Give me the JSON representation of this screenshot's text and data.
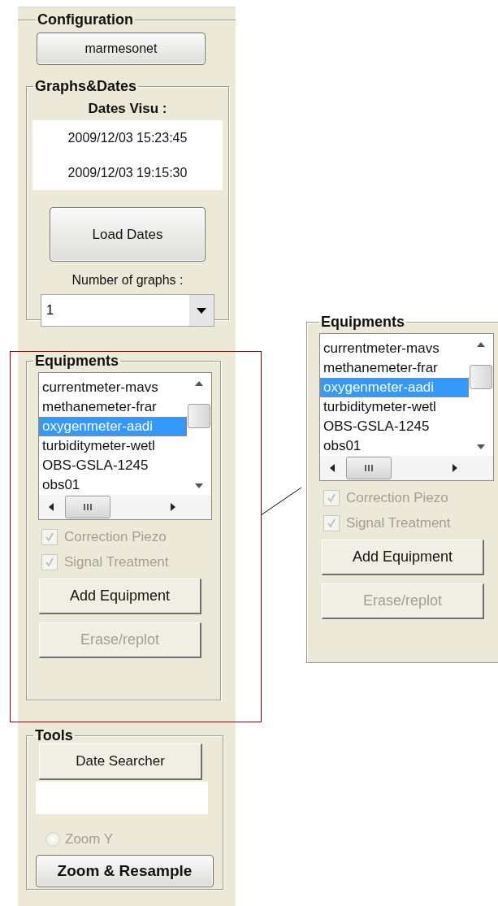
{
  "configuration": {
    "title": "Configuration",
    "button": "marmesonet"
  },
  "graphs_dates": {
    "title": "Graphs&Dates",
    "dates_label": "Dates Visu :",
    "dates": [
      "2009/12/03 15:23:45",
      "2009/12/03 19:15:30"
    ],
    "load_button": "Load Dates",
    "graphs_label": "Number of graphs :",
    "graphs_value": "1"
  },
  "equipments": {
    "title": "Equipments",
    "items": [
      {
        "label": "currentmeter-mavs",
        "selected": false
      },
      {
        "label": "methanemeter-frar",
        "selected": false
      },
      {
        "label": "oxygenmeter-aadi",
        "selected": true
      },
      {
        "label": "turbiditymeter-wetl",
        "selected": false
      },
      {
        "label": "OBS-GSLA-1245",
        "selected": false
      },
      {
        "label": "obs01",
        "selected": false
      }
    ],
    "checkboxes": [
      {
        "label": "Correction Piezo",
        "checked": true,
        "disabled": true
      },
      {
        "label": "Signal Treatment",
        "checked": true,
        "disabled": true
      }
    ],
    "buttons": [
      {
        "label": "Add Equipment",
        "disabled": false
      },
      {
        "label": "Erase/replot",
        "disabled": true
      }
    ]
  },
  "equipments_zoom": {
    "title": "Equipments",
    "items": [
      {
        "label": "currentmeter-mavs",
        "selected": false
      },
      {
        "label": "methanemeter-frar",
        "selected": false
      },
      {
        "label": "oxygenmeter-aadi",
        "selected": true
      },
      {
        "label": "turbiditymeter-wetl",
        "selected": false
      },
      {
        "label": "OBS-GSLA-1245",
        "selected": false
      },
      {
        "label": "obs01",
        "selected": false
      }
    ],
    "checkboxes": [
      {
        "label": "Correction Piezo",
        "checked": true,
        "disabled": true
      },
      {
        "label": "Signal Treatment",
        "checked": true,
        "disabled": true
      }
    ],
    "buttons": [
      {
        "label": "Add Equipment",
        "disabled": false
      },
      {
        "label": "Erase/replot",
        "disabled": true
      }
    ]
  },
  "tools": {
    "title": "Tools",
    "button": "Date Searcher",
    "radio": {
      "label": "Zoom Y",
      "selected": false,
      "disabled": true
    },
    "zoom_button": "Zoom & Resample"
  }
}
